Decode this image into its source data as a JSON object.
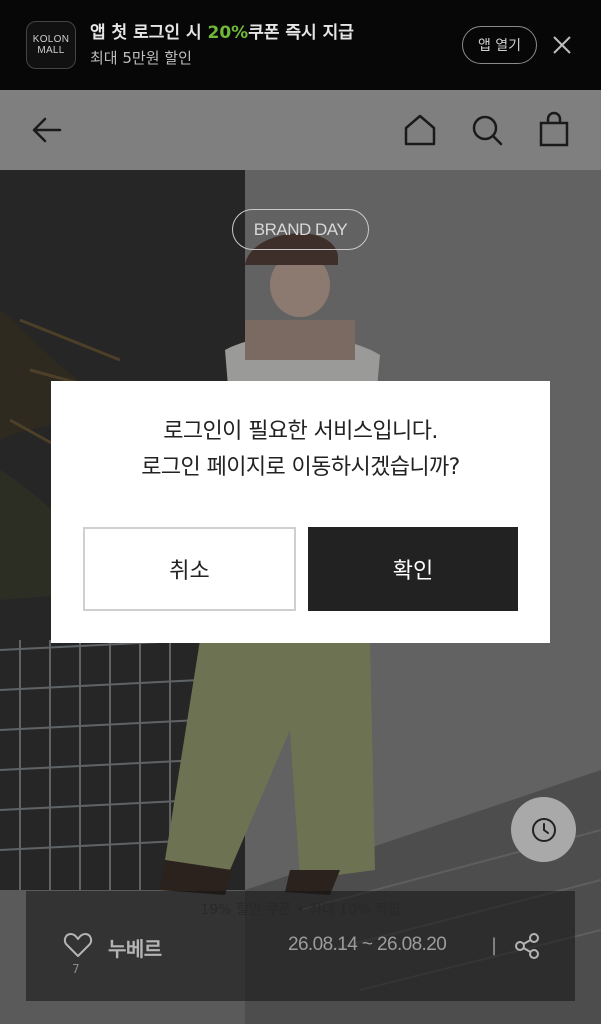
{
  "app_banner": {
    "logo_line1": "KOLON",
    "logo_line2": "MALL",
    "title_prefix": "앱 첫 로그인 시 ",
    "title_accent": "20%",
    "title_suffix": "쿠폰 즉시 지급",
    "subtitle": "최대 5만원 할인",
    "open_app_label": "앱 열기",
    "close_icon": "close-icon",
    "accent_color": "#6fb83a"
  },
  "header": {
    "back_icon": "arrow-left-icon",
    "home_icon": "home-icon",
    "search_icon": "search-icon",
    "cart_icon": "shopping-bag-icon"
  },
  "hero": {
    "badge": "BRAND DAY",
    "faded_text": "19% 할인 쿠폰 • 최대 10% 적립",
    "brand_name": "누베르",
    "like_count": "7",
    "date_range": "26.08.14 ~ 26.08.20",
    "divider": "|",
    "recent_icon": "clock-icon",
    "heart_icon": "heart-icon",
    "share_icon": "share-icon"
  },
  "modal": {
    "message_line1": "로그인이 필요한 서비스입니다.",
    "message_line2": "로그인 페이지로 이동하시겠습니까?",
    "cancel_label": "취소",
    "confirm_label": "확인"
  }
}
